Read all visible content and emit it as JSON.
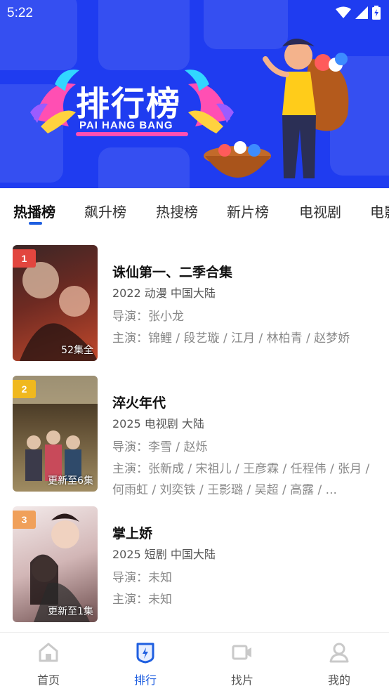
{
  "status_bar": {
    "time": "5:22"
  },
  "banner": {
    "title": "排行榜",
    "subtitle": "PAI HANG BANG"
  },
  "tabs": [
    {
      "label": "热播榜",
      "active": true
    },
    {
      "label": "飙升榜",
      "active": false
    },
    {
      "label": "热搜榜",
      "active": false
    },
    {
      "label": "新片榜",
      "active": false
    },
    {
      "label": "电视剧",
      "active": false
    },
    {
      "label": "电影",
      "active": false
    }
  ],
  "items": [
    {
      "rank": "1",
      "rank_color": "#e2463f",
      "title": "诛仙第一、二季合集",
      "meta": "2022  动漫  中国大陆",
      "director": "导演：张小龙",
      "cast": "主演：锦鲤 / 段艺璇 / 江月 / 林柏青 / 赵梦娇",
      "badge": "52集全",
      "poster_colors": [
        "#2a1c1c",
        "#7a2a22",
        "#c94a2c"
      ]
    },
    {
      "rank": "2",
      "rank_color": "#f0b81e",
      "title": "淬火年代",
      "meta": "2025  电视剧  大陆",
      "director": "导演：李雪 / 赵烁",
      "cast": "主演：张新成 / 宋祖儿 / 王彦霖 / 任程伟 / 张月 / 何雨虹 / 刘奕铁 / 王影璐 / 吴超 / 高露 / ...",
      "badge": "更新至6集",
      "poster_colors": [
        "#3a2a1a",
        "#6b5433",
        "#9b8a5a"
      ]
    },
    {
      "rank": "3",
      "rank_color": "#f0a05a",
      "title": "掌上娇",
      "meta": "2025  短剧  中国大陆",
      "director": "导演：未知",
      "cast": "主演：未知",
      "badge": "更新至1集",
      "poster_colors": [
        "#e8dada",
        "#c9a8a8",
        "#7a5858"
      ]
    }
  ],
  "bottom_nav": [
    {
      "label": "首页",
      "icon": "home-icon",
      "active": false
    },
    {
      "label": "排行",
      "icon": "ranking-icon",
      "active": true
    },
    {
      "label": "找片",
      "icon": "video-camera-icon",
      "active": false
    },
    {
      "label": "我的",
      "icon": "user-icon",
      "active": false
    }
  ],
  "colors": {
    "accent": "#1f5fe0",
    "banner": "#1f3cf0"
  }
}
